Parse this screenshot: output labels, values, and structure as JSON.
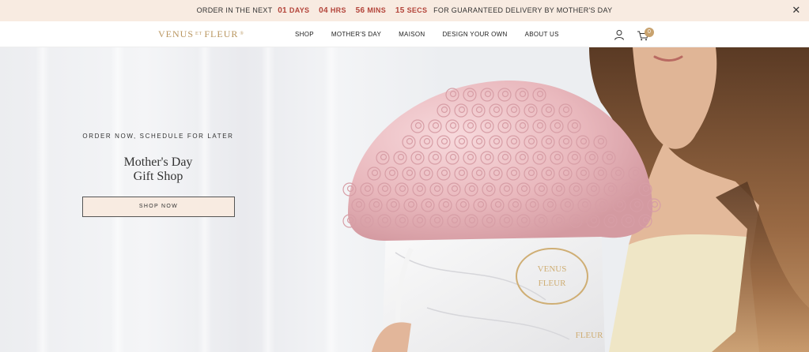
{
  "announcement": {
    "prefix": "ORDER IN THE NEXT",
    "countdown": [
      {
        "value": "01",
        "unit": "DAYS"
      },
      {
        "value": "04",
        "unit": "HRS"
      },
      {
        "value": "56",
        "unit": "MINS"
      },
      {
        "value": "15",
        "unit": "SECS"
      }
    ],
    "suffix": "FOR GUARANTEED DELIVERY BY MOTHER'S DAY",
    "close_icon": "close-icon"
  },
  "header": {
    "logo_left": "VENUS",
    "logo_et": "ET",
    "logo_right": "FLEUR",
    "logo_mark": "®",
    "nav": [
      "SHOP",
      "MOTHER'S DAY",
      "MAISON",
      "DESIGN YOUR OWN",
      "ABOUT US"
    ],
    "account_icon": "user-icon",
    "cart_icon": "cart-icon",
    "cart_count": "0"
  },
  "hero": {
    "eyebrow": "ORDER NOW, SCHEDULE FOR LATER",
    "title_line1": "Mother's Day",
    "title_line2": "Gift Shop",
    "cta": "SHOP NOW",
    "box_text_line1": "VENUS",
    "box_text_line2": "FLEUR",
    "box_text_bottom": "FLEUR"
  },
  "colors": {
    "announce_bg": "#f8ebe1",
    "countdown": "#b3443a",
    "logo_gold": "#b99660",
    "cta_bg": "#f8ebe1",
    "rose_pink": "#e9b8bd"
  }
}
